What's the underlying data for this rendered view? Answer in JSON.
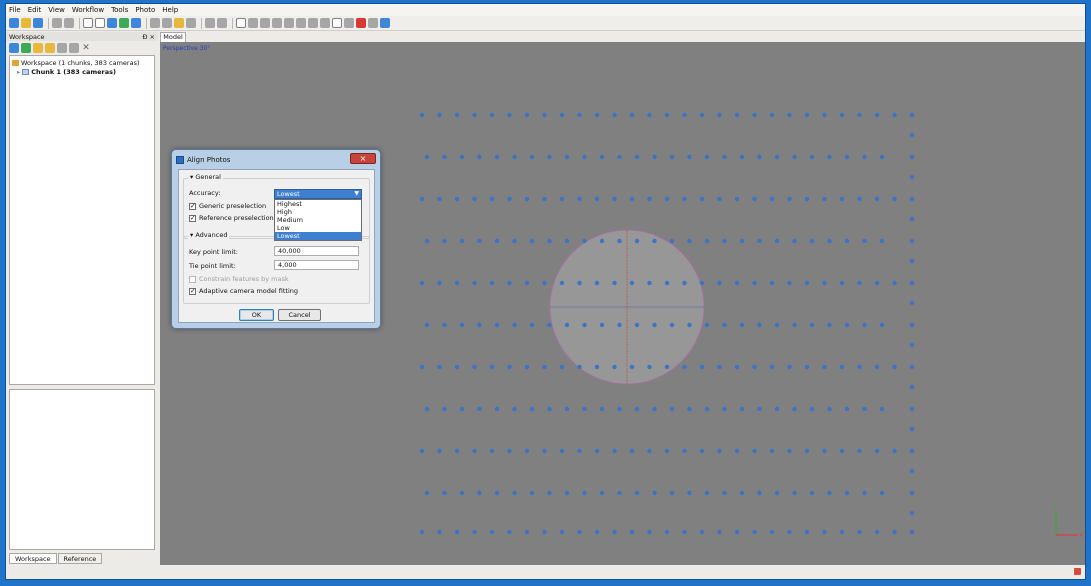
{
  "menu": [
    "File",
    "Edit",
    "View",
    "Workflow",
    "Tools",
    "Photo",
    "Help"
  ],
  "workspace_panel": {
    "title": "Workspace",
    "controls": "Ɖ ×",
    "tree": {
      "root_label": "Workspace (1 chunks, 383 cameras)",
      "chunk_label": "Chunk 1 (383 cameras)"
    },
    "tabs": [
      "Workspace",
      "Reference"
    ]
  },
  "viewport": {
    "tab_label": "Model",
    "projection_label": "Perspective 30°",
    "axis_labels": {
      "y": "Y",
      "x": "X"
    }
  },
  "dialog": {
    "title": "Align Photos",
    "general_group": "General",
    "accuracy_label": "Accuracy:",
    "accuracy_value": "Lowest",
    "accuracy_options": [
      "Highest",
      "High",
      "Medium",
      "Low",
      "Lowest"
    ],
    "generic_preselection": "Generic preselection",
    "reference_preselection": "Reference preselection",
    "advanced_group": "Advanced",
    "key_point_label": "Key point limit:",
    "key_point_value": "40,000",
    "tie_point_label": "Tie point limit:",
    "tie_point_value": "4,000",
    "constrain_label": "Constrain features by mask",
    "adaptive_label": "Adaptive camera model fitting",
    "ok_label": "OK",
    "cancel_label": "Cancel"
  },
  "colors": {
    "camera_dot": "#3a73c8",
    "viewport_bg": "#808080",
    "trackball": "#a9a9a9"
  }
}
